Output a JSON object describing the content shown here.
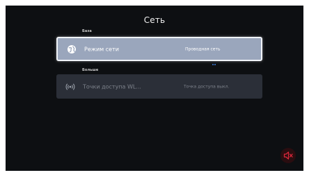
{
  "header": {
    "title": "Сеть"
  },
  "sections": {
    "basic_label": "База",
    "more_label": "Больше"
  },
  "rows": {
    "network_mode": {
      "label": "Режим сети",
      "value": "Проводная сеть",
      "icon": "globe-icon",
      "focused": true
    },
    "hotspot": {
      "label": "Точки доступа WL...",
      "value": "Точка доступа выкл.",
      "icon": "hotspot-icon",
      "enabled": false
    }
  },
  "mute": {
    "icon": "speaker-muted-icon",
    "color": "#e0283c"
  },
  "colors": {
    "background": "#0d0f12",
    "focused_row": "#9aa6bc",
    "row": "#2b2f38",
    "accent": "#3d7fe0"
  }
}
